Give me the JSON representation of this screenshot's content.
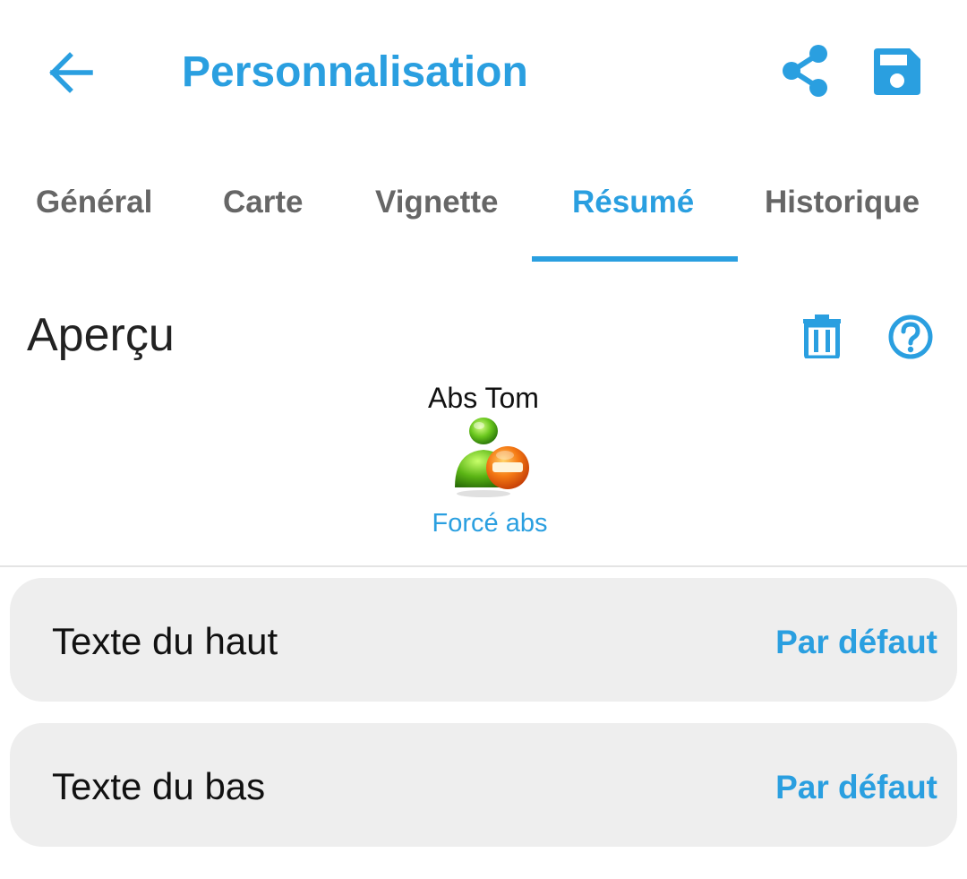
{
  "header": {
    "title": "Personnalisation",
    "back_icon": "arrow-left-icon",
    "share_icon": "share-icon",
    "save_icon": "save-icon"
  },
  "tabs": [
    {
      "label": "Général",
      "active": false
    },
    {
      "label": "Carte",
      "active": false
    },
    {
      "label": "Vignette",
      "active": false
    },
    {
      "label": "Résumé",
      "active": true
    },
    {
      "label": "Historique",
      "active": false
    }
  ],
  "preview": {
    "heading": "Aperçu",
    "delete_icon": "trash-icon",
    "help_icon": "help-icon",
    "name": "Abs Tom",
    "status_icon": "user-forced-absent-icon",
    "status": "Forcé abs"
  },
  "settings": [
    {
      "label": "Texte du haut",
      "value": "Par défaut"
    },
    {
      "label": "Texte du bas",
      "value": "Par défaut"
    }
  ],
  "colors": {
    "accent": "#2a9fe0",
    "tab_inactive": "#666666",
    "row_background": "#eeeeee"
  }
}
